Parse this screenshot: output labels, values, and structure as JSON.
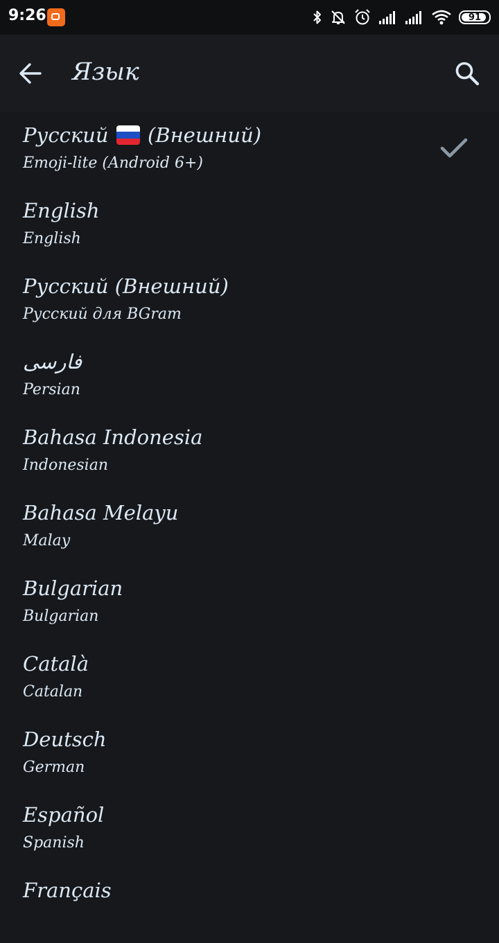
{
  "status_bar": {
    "time": "9:26",
    "battery_level": 91,
    "battery_text": "91",
    "icons": [
      "app-notification-icon",
      "bluetooth-icon",
      "bell-muted-icon",
      "alarm-icon",
      "signal-1-icon",
      "signal-2-icon",
      "wifi-icon",
      "battery-icon"
    ]
  },
  "toolbar": {
    "title": "Язык",
    "back_icon": "arrow-left-icon",
    "search_icon": "search-icon"
  },
  "languages": [
    {
      "name": "Русский",
      "name_suffix": "(Внешний)",
      "flag": "russia-flag",
      "sub": "Emoji-lite (Android 6+)",
      "selected": true
    },
    {
      "name": "English",
      "sub": "English"
    },
    {
      "name": "Русский (Внешний)",
      "sub": "Русский для BGram"
    },
    {
      "name": "فارسی",
      "sub": "Persian"
    },
    {
      "name": "Bahasa Indonesia",
      "sub": "Indonesian"
    },
    {
      "name": "Bahasa Melayu",
      "sub": "Malay"
    },
    {
      "name": "Bulgarian",
      "sub": "Bulgarian"
    },
    {
      "name": "Català",
      "sub": "Catalan"
    },
    {
      "name": "Deutsch",
      "sub": "German"
    },
    {
      "name": "Español",
      "sub": "Spanish"
    },
    {
      "name": "Français",
      "sub": ""
    }
  ],
  "colors": {
    "background": "#16181b",
    "toolbar": "#191b1e",
    "status_bar": "#0f1012",
    "text": "#dde9f5",
    "check": "#8a98a6",
    "app_icon": "#f26a1b"
  }
}
